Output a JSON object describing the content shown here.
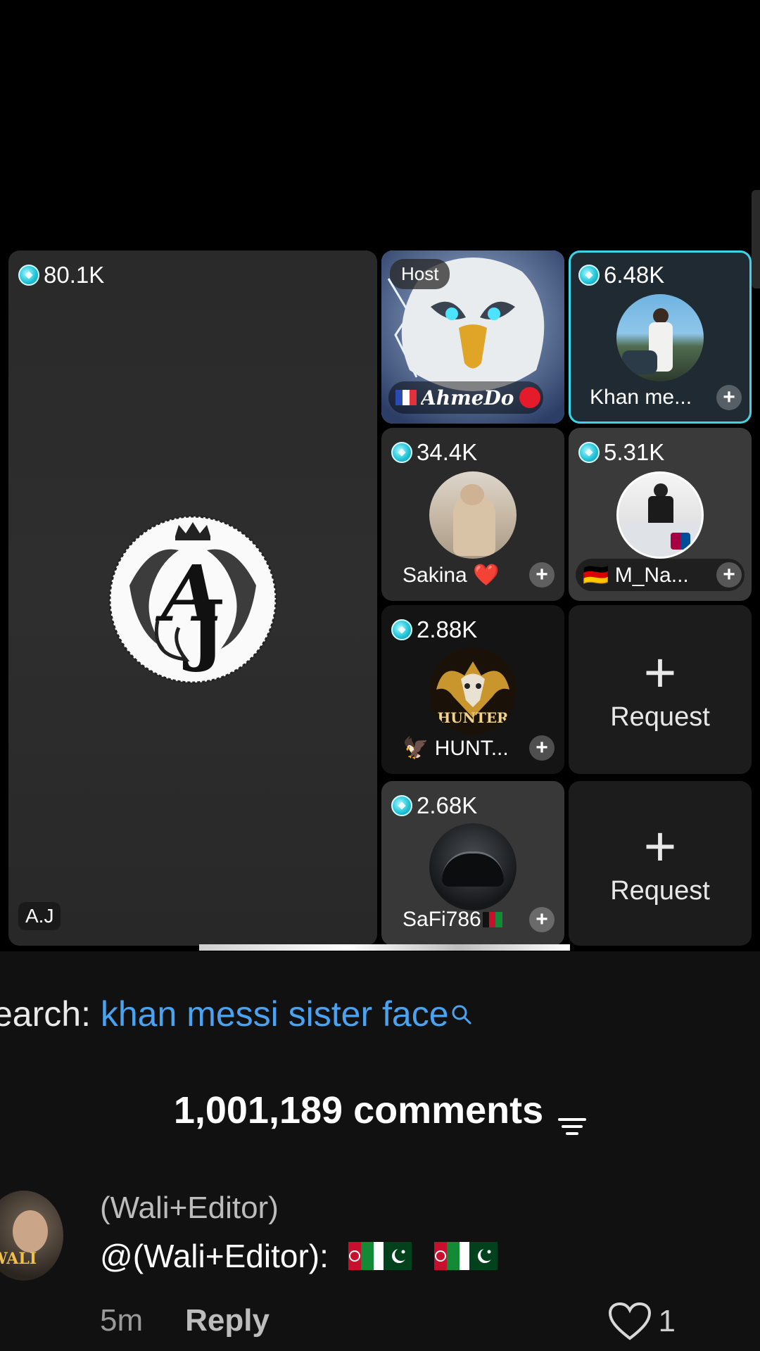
{
  "big_tile": {
    "score": "80.1K",
    "name": "A.J"
  },
  "host_tile": {
    "badge": "Host",
    "flag_icon": "france-flag-icon",
    "name": "AhmeDo",
    "status_icon": "red-dot-icon"
  },
  "tiles": [
    {
      "score": "6.48K",
      "name": "Khan me...",
      "add": "+"
    },
    {
      "score": "34.4K",
      "name": "Sakina",
      "emoji": "❤️",
      "add": "+"
    },
    {
      "score": "5.31K",
      "flag": "🇩🇪",
      "name": "M_Na...",
      "add": "+"
    },
    {
      "score": "2.88K",
      "emoji": "🦅",
      "name": "HUNT...",
      "add": "+",
      "logo_text": "HUNTER"
    },
    {
      "score": "2.68K",
      "name": "SaFi786",
      "flag_icon": "afghanistan-flag-icon",
      "add": "+"
    }
  ],
  "request_slots": [
    {
      "plus": "+",
      "label": "Request"
    },
    {
      "plus": "+",
      "label": "Request"
    }
  ],
  "search": {
    "prefix": "earch:",
    "term": "khan messi sister face"
  },
  "comments": {
    "count_label": "1,001,189 comments"
  },
  "comment": {
    "user": "(Wali+Editor)",
    "text": "@(Wali+Editor):",
    "time": "5m",
    "reply": "Reply",
    "likes": "1",
    "avatar_text": "WALI"
  },
  "colors": {
    "accent_cyan": "#3ad5e8",
    "search_blue": "#4aa3f0",
    "panel_bg": "#111111"
  }
}
